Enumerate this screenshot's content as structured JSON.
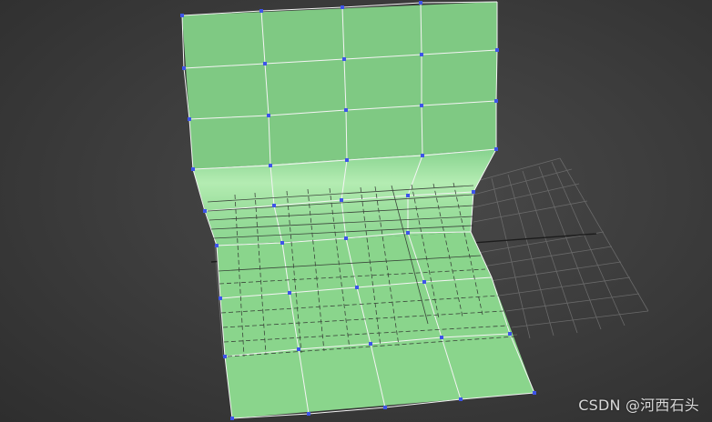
{
  "watermark": {
    "text": "CSDN @河西石头"
  }
}
